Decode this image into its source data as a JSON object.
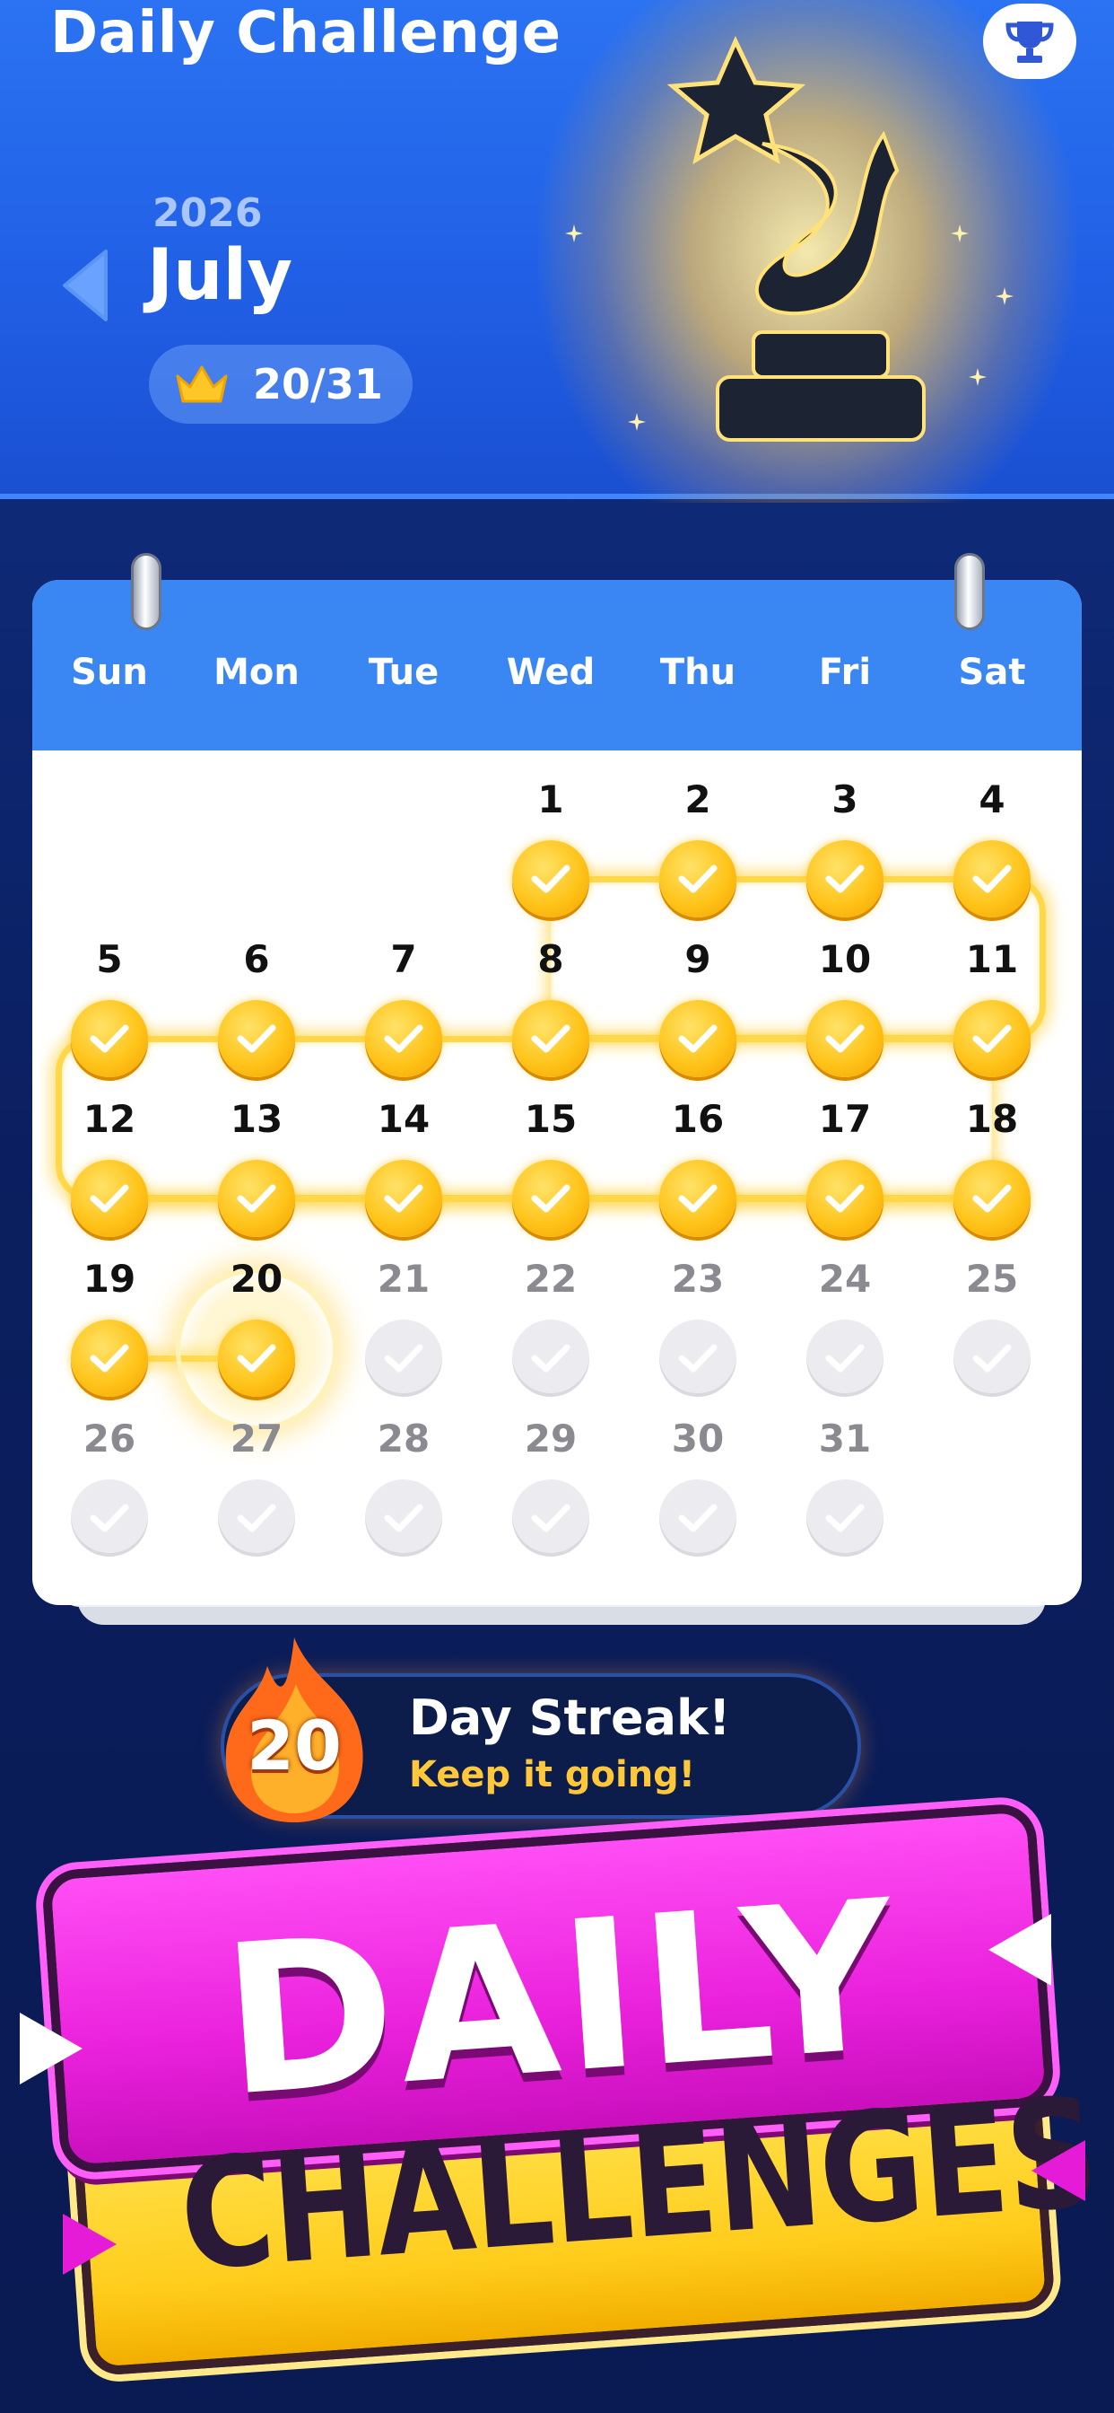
{
  "header": {
    "title": "Daily Challenge",
    "year": "2026",
    "month": "July",
    "progress": "20/31",
    "trophy_button_icon": "trophy-icon",
    "back_icon": "chevron-left-icon"
  },
  "calendar": {
    "weekdays": [
      "Sun",
      "Mon",
      "Tue",
      "Wed",
      "Thu",
      "Fri",
      "Sat"
    ],
    "first_weekday_index": 3,
    "days_in_month": 31,
    "completed_through": 20,
    "today": 20,
    "days": [
      {
        "label": "1"
      },
      {
        "label": "2"
      },
      {
        "label": "3"
      },
      {
        "label": "4"
      },
      {
        "label": "5"
      },
      {
        "label": "6"
      },
      {
        "label": "7"
      },
      {
        "label": "8"
      },
      {
        "label": "9"
      },
      {
        "label": "10"
      },
      {
        "label": "11"
      },
      {
        "label": "12"
      },
      {
        "label": "13"
      },
      {
        "label": "14"
      },
      {
        "label": "15"
      },
      {
        "label": "16"
      },
      {
        "label": "17"
      },
      {
        "label": "18"
      },
      {
        "label": "19"
      },
      {
        "label": "20"
      },
      {
        "label": "21"
      },
      {
        "label": "22"
      },
      {
        "label": "23"
      },
      {
        "label": "24"
      },
      {
        "label": "25"
      },
      {
        "label": "26"
      },
      {
        "label": "27"
      },
      {
        "label": "28"
      },
      {
        "label": "29"
      },
      {
        "label": "30"
      },
      {
        "label": "31"
      }
    ]
  },
  "streak": {
    "count": "20",
    "title": "Day Streak!",
    "subtitle": "Keep it going!",
    "icon": "flame-icon"
  },
  "banner": {
    "line1": "DAILY",
    "line2": "CHALLENGES"
  },
  "colors": {
    "header_blue": "#2b73f2",
    "calendar_header": "#3a86f2",
    "gold": "#ffc41a",
    "streak_yellow": "#ffc83a",
    "banner_pink": "#ea21dc",
    "banner_yellow": "#ffcc1b"
  }
}
